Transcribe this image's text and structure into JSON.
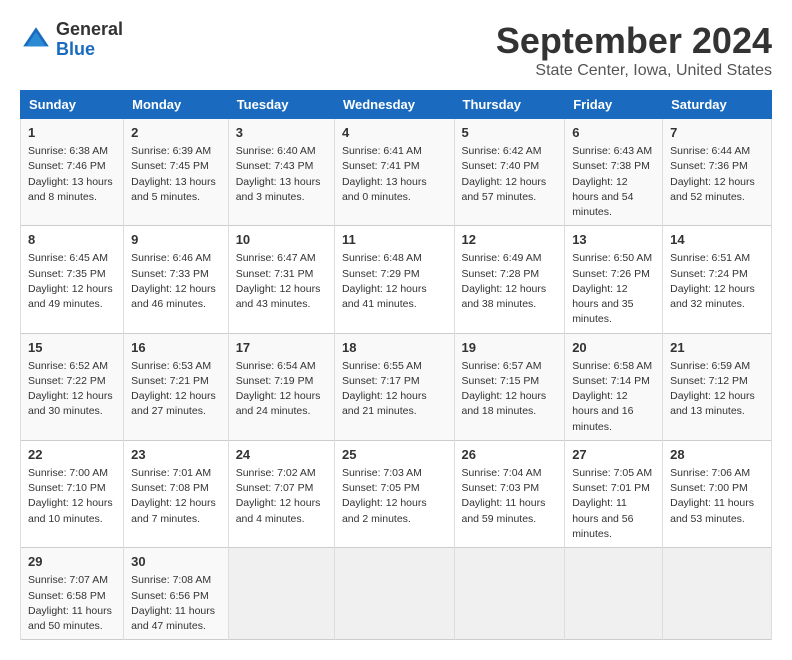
{
  "logo": {
    "line1": "General",
    "line2": "Blue"
  },
  "title": "September 2024",
  "subtitle": "State Center, Iowa, United States",
  "weekdays": [
    "Sunday",
    "Monday",
    "Tuesday",
    "Wednesday",
    "Thursday",
    "Friday",
    "Saturday"
  ],
  "weeks": [
    [
      {
        "day": "1",
        "sunrise": "Sunrise: 6:38 AM",
        "sunset": "Sunset: 7:46 PM",
        "daylight": "Daylight: 13 hours and 8 minutes."
      },
      {
        "day": "2",
        "sunrise": "Sunrise: 6:39 AM",
        "sunset": "Sunset: 7:45 PM",
        "daylight": "Daylight: 13 hours and 5 minutes."
      },
      {
        "day": "3",
        "sunrise": "Sunrise: 6:40 AM",
        "sunset": "Sunset: 7:43 PM",
        "daylight": "Daylight: 13 hours and 3 minutes."
      },
      {
        "day": "4",
        "sunrise": "Sunrise: 6:41 AM",
        "sunset": "Sunset: 7:41 PM",
        "daylight": "Daylight: 13 hours and 0 minutes."
      },
      {
        "day": "5",
        "sunrise": "Sunrise: 6:42 AM",
        "sunset": "Sunset: 7:40 PM",
        "daylight": "Daylight: 12 hours and 57 minutes."
      },
      {
        "day": "6",
        "sunrise": "Sunrise: 6:43 AM",
        "sunset": "Sunset: 7:38 PM",
        "daylight": "Daylight: 12 hours and 54 minutes."
      },
      {
        "day": "7",
        "sunrise": "Sunrise: 6:44 AM",
        "sunset": "Sunset: 7:36 PM",
        "daylight": "Daylight: 12 hours and 52 minutes."
      }
    ],
    [
      {
        "day": "8",
        "sunrise": "Sunrise: 6:45 AM",
        "sunset": "Sunset: 7:35 PM",
        "daylight": "Daylight: 12 hours and 49 minutes."
      },
      {
        "day": "9",
        "sunrise": "Sunrise: 6:46 AM",
        "sunset": "Sunset: 7:33 PM",
        "daylight": "Daylight: 12 hours and 46 minutes."
      },
      {
        "day": "10",
        "sunrise": "Sunrise: 6:47 AM",
        "sunset": "Sunset: 7:31 PM",
        "daylight": "Daylight: 12 hours and 43 minutes."
      },
      {
        "day": "11",
        "sunrise": "Sunrise: 6:48 AM",
        "sunset": "Sunset: 7:29 PM",
        "daylight": "Daylight: 12 hours and 41 minutes."
      },
      {
        "day": "12",
        "sunrise": "Sunrise: 6:49 AM",
        "sunset": "Sunset: 7:28 PM",
        "daylight": "Daylight: 12 hours and 38 minutes."
      },
      {
        "day": "13",
        "sunrise": "Sunrise: 6:50 AM",
        "sunset": "Sunset: 7:26 PM",
        "daylight": "Daylight: 12 hours and 35 minutes."
      },
      {
        "day": "14",
        "sunrise": "Sunrise: 6:51 AM",
        "sunset": "Sunset: 7:24 PM",
        "daylight": "Daylight: 12 hours and 32 minutes."
      }
    ],
    [
      {
        "day": "15",
        "sunrise": "Sunrise: 6:52 AM",
        "sunset": "Sunset: 7:22 PM",
        "daylight": "Daylight: 12 hours and 30 minutes."
      },
      {
        "day": "16",
        "sunrise": "Sunrise: 6:53 AM",
        "sunset": "Sunset: 7:21 PM",
        "daylight": "Daylight: 12 hours and 27 minutes."
      },
      {
        "day": "17",
        "sunrise": "Sunrise: 6:54 AM",
        "sunset": "Sunset: 7:19 PM",
        "daylight": "Daylight: 12 hours and 24 minutes."
      },
      {
        "day": "18",
        "sunrise": "Sunrise: 6:55 AM",
        "sunset": "Sunset: 7:17 PM",
        "daylight": "Daylight: 12 hours and 21 minutes."
      },
      {
        "day": "19",
        "sunrise": "Sunrise: 6:57 AM",
        "sunset": "Sunset: 7:15 PM",
        "daylight": "Daylight: 12 hours and 18 minutes."
      },
      {
        "day": "20",
        "sunrise": "Sunrise: 6:58 AM",
        "sunset": "Sunset: 7:14 PM",
        "daylight": "Daylight: 12 hours and 16 minutes."
      },
      {
        "day": "21",
        "sunrise": "Sunrise: 6:59 AM",
        "sunset": "Sunset: 7:12 PM",
        "daylight": "Daylight: 12 hours and 13 minutes."
      }
    ],
    [
      {
        "day": "22",
        "sunrise": "Sunrise: 7:00 AM",
        "sunset": "Sunset: 7:10 PM",
        "daylight": "Daylight: 12 hours and 10 minutes."
      },
      {
        "day": "23",
        "sunrise": "Sunrise: 7:01 AM",
        "sunset": "Sunset: 7:08 PM",
        "daylight": "Daylight: 12 hours and 7 minutes."
      },
      {
        "day": "24",
        "sunrise": "Sunrise: 7:02 AM",
        "sunset": "Sunset: 7:07 PM",
        "daylight": "Daylight: 12 hours and 4 minutes."
      },
      {
        "day": "25",
        "sunrise": "Sunrise: 7:03 AM",
        "sunset": "Sunset: 7:05 PM",
        "daylight": "Daylight: 12 hours and 2 minutes."
      },
      {
        "day": "26",
        "sunrise": "Sunrise: 7:04 AM",
        "sunset": "Sunset: 7:03 PM",
        "daylight": "Daylight: 11 hours and 59 minutes."
      },
      {
        "day": "27",
        "sunrise": "Sunrise: 7:05 AM",
        "sunset": "Sunset: 7:01 PM",
        "daylight": "Daylight: 11 hours and 56 minutes."
      },
      {
        "day": "28",
        "sunrise": "Sunrise: 7:06 AM",
        "sunset": "Sunset: 7:00 PM",
        "daylight": "Daylight: 11 hours and 53 minutes."
      }
    ],
    [
      {
        "day": "29",
        "sunrise": "Sunrise: 7:07 AM",
        "sunset": "Sunset: 6:58 PM",
        "daylight": "Daylight: 11 hours and 50 minutes."
      },
      {
        "day": "30",
        "sunrise": "Sunrise: 7:08 AM",
        "sunset": "Sunset: 6:56 PM",
        "daylight": "Daylight: 11 hours and 47 minutes."
      },
      null,
      null,
      null,
      null,
      null
    ]
  ]
}
